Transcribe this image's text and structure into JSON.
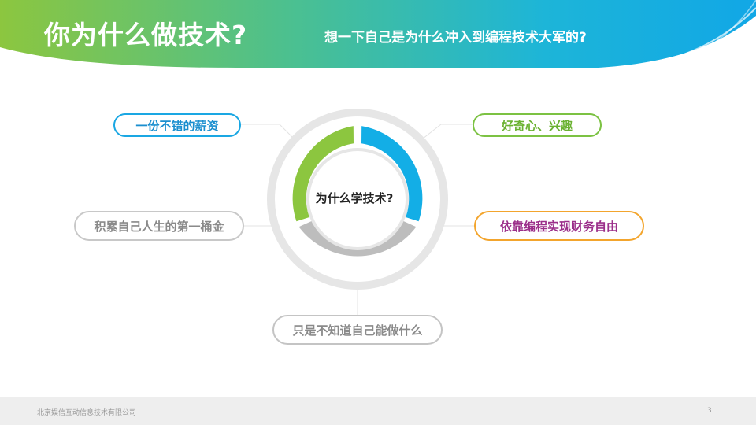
{
  "header": {
    "title": "你为什么做技术?",
    "subtitle": "想一下自己是为什么冲入到编程技术大军的?"
  },
  "diagram": {
    "center_label": "为什么学技术?",
    "reasons": {
      "salary": "一份不错的薪资",
      "curiosity": "好奇心、兴趣",
      "first_pot_of_gold": "积累自己人生的第一桶金",
      "financial_freedom": "依靠编程实现财务自由",
      "unknown": "只是不知道自己能做什么"
    },
    "colors": {
      "green": "#8cc63f",
      "blue": "#13aee6",
      "gray": "#bdbdbd",
      "outer_ring": "#e6e6e6",
      "orange": "#f3a52d",
      "purple": "#9b2f8a"
    }
  },
  "footer": {
    "company": "北京娱信互动信息技术有限公司",
    "page_number": "3"
  }
}
